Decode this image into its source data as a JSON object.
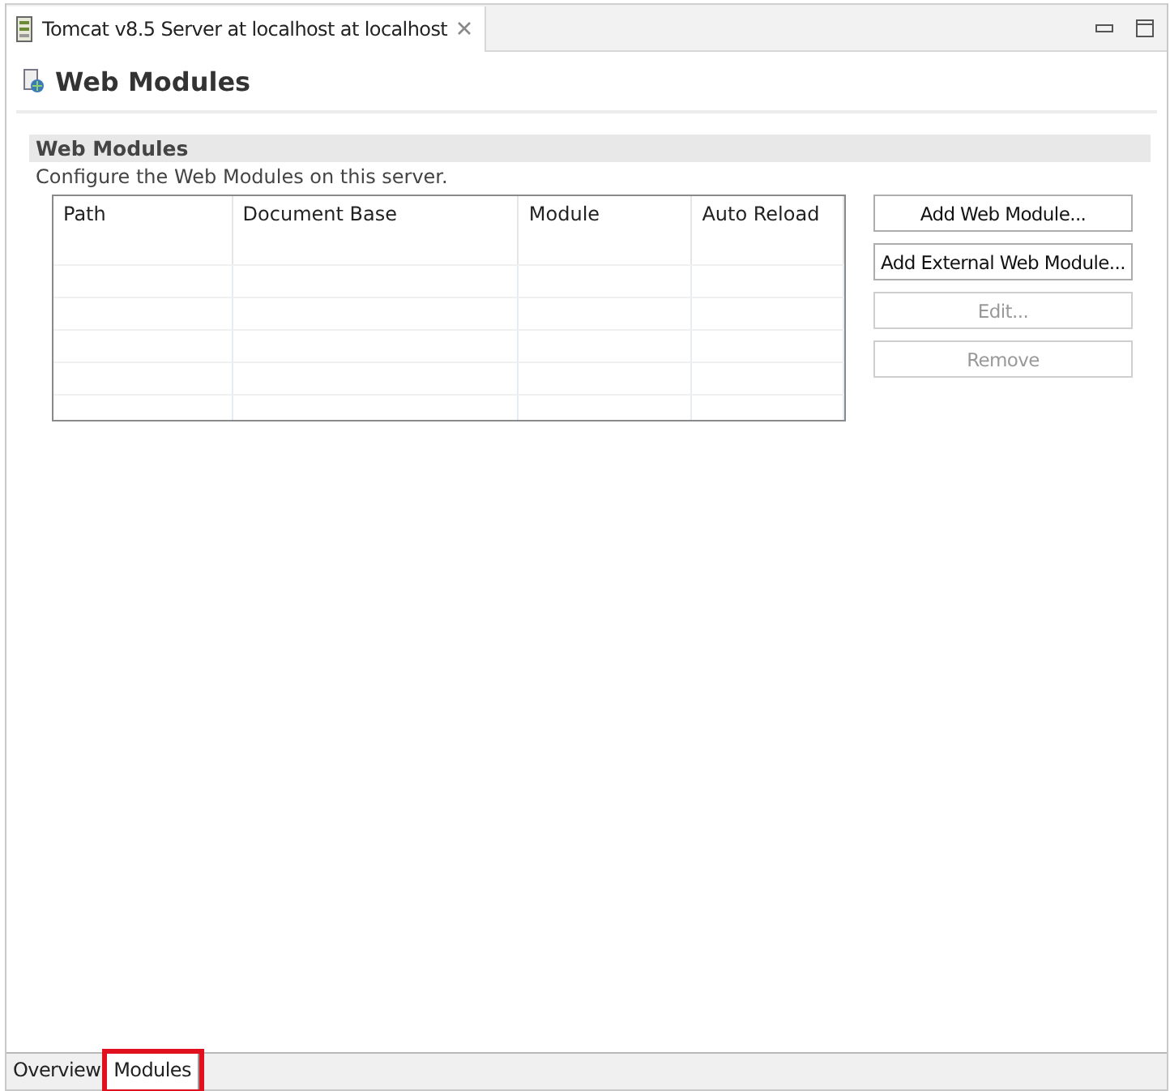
{
  "editor_tab": {
    "title": "Tomcat v8.5 Server at localhost at localhost"
  },
  "page_title": "Web Modules",
  "section": {
    "title": "Web Modules",
    "description": "Configure the Web Modules on this server."
  },
  "table": {
    "columns": [
      "Path",
      "Document Base",
      "Module",
      "Auto Reload"
    ]
  },
  "buttons": [
    {
      "label": "Add Web Module...",
      "disabled": false
    },
    {
      "label": "Add External Web Module...",
      "disabled": false
    },
    {
      "label": "Edit...",
      "disabled": true
    },
    {
      "label": "Remove",
      "disabled": true
    }
  ],
  "bottom_tabs": [
    {
      "label": "Overview",
      "selected": false,
      "highlighted": false
    },
    {
      "label": "Modules",
      "selected": true,
      "highlighted": true
    }
  ]
}
